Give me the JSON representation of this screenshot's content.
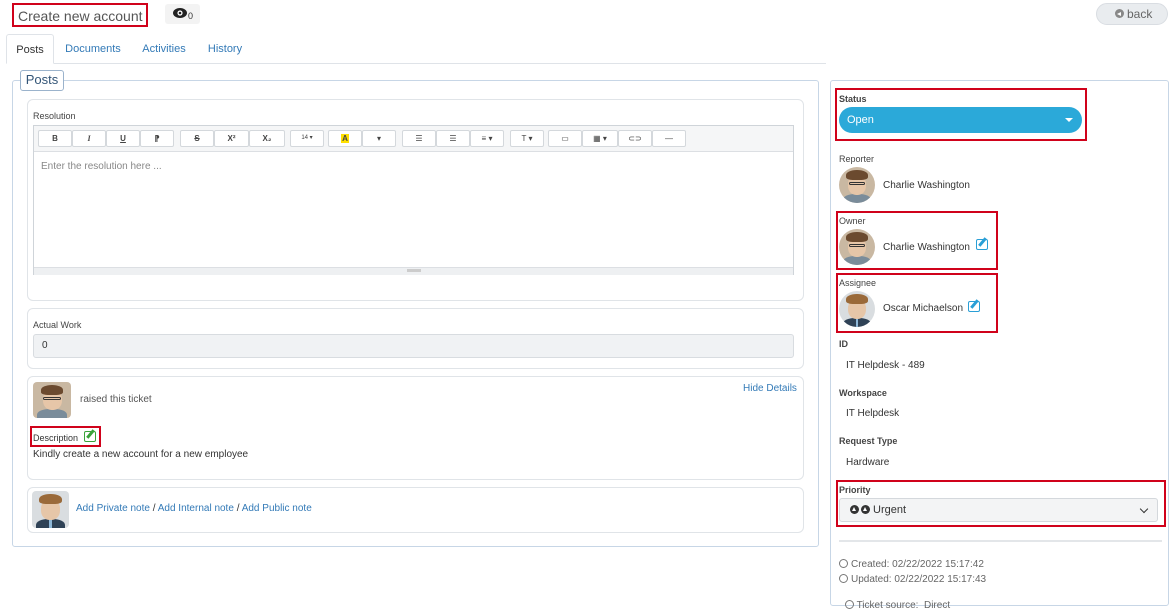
{
  "header": {
    "title": "Create new account",
    "watch_count": "0",
    "back_label": "back"
  },
  "tabs": [
    {
      "label": "Posts"
    },
    {
      "label": "Documents"
    },
    {
      "label": "Activities"
    },
    {
      "label": "History"
    }
  ],
  "posts": {
    "legend": "Posts",
    "resolution": {
      "label": "Resolution",
      "placeholder": "Enter the resolution here ...",
      "toolbar": {
        "bold": "B",
        "italic": "I",
        "underline": "U",
        "clear": "⁋",
        "strike": "S",
        "superscript": "X²",
        "subscript": "X₂",
        "font_size": "14 ▾",
        "highlight": "A",
        "color": "▾",
        "ul": "☰",
        "ol": "☰",
        "align": "≡ ▾",
        "text_style": "T ▾",
        "image": "▭",
        "table": "▦ ▾",
        "link": "⊂⊃",
        "hr": "—"
      }
    },
    "actual_work": {
      "label": "Actual Work",
      "value": "0"
    },
    "ticket_raise": {
      "text": "raised this ticket",
      "hide_details": "Hide Details",
      "description_label": "Description",
      "description": "Kindly create a new account for a new employee"
    },
    "notes": {
      "private": "Add Private note",
      "sep1": "/",
      "internal": "Add Internal note",
      "sep2": "/",
      "public": "Add Public note"
    }
  },
  "details": {
    "status_label": "Status",
    "status_value": "Open",
    "reporter_label": "Reporter",
    "reporter_name": "Charlie Washington",
    "owner_label": "Owner",
    "owner_name": "Charlie Washington",
    "assignee_label": "Assignee",
    "assignee_name": "Oscar Michaelson",
    "id_label": "ID",
    "id_value": "IT Helpdesk - 489",
    "workspace_label": "Workspace",
    "workspace_value": "IT Helpdesk",
    "request_type_label": "Request Type",
    "request_type_value": "Hardware",
    "priority_label": "Priority",
    "priority_value": "Urgent",
    "created": "Created: 02/22/2022 15:17:42",
    "updated": "Updated: 02/22/2022 15:17:43",
    "source": "Ticket source:  Direct"
  },
  "colors": {
    "highlight_box": "#d0021b",
    "status_blue": "#2ba9d9",
    "link_blue": "#337ab7"
  }
}
